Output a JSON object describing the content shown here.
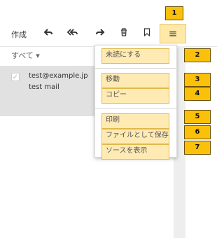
{
  "toolbar": {
    "compose_label": "作成",
    "icons": {
      "reply": "↰",
      "reply_all": "↰↰",
      "forward": "↱",
      "delete": "🗑",
      "bookmark": "⊓",
      "menu": "≡"
    }
  },
  "filter": {
    "label": "すべて ▾"
  },
  "email": {
    "from": "test@example.jp",
    "subject": "test mail",
    "check": "✓"
  },
  "menu": {
    "mark_unread": "未読にする",
    "move": "移動",
    "copy": "コピー",
    "print": "印刷",
    "save_as_file": "ファイルとして保存",
    "view_source": "ソースを表示"
  },
  "badges": {
    "menu_button": "1",
    "mark_unread": "2",
    "move": "3",
    "copy": "4",
    "print": "5",
    "save_as_file": "6",
    "view_source": "7"
  },
  "colors": {
    "highlight": "#ffeab3",
    "badge": "#fbc10a",
    "selected_row": "#e1e1e1"
  }
}
